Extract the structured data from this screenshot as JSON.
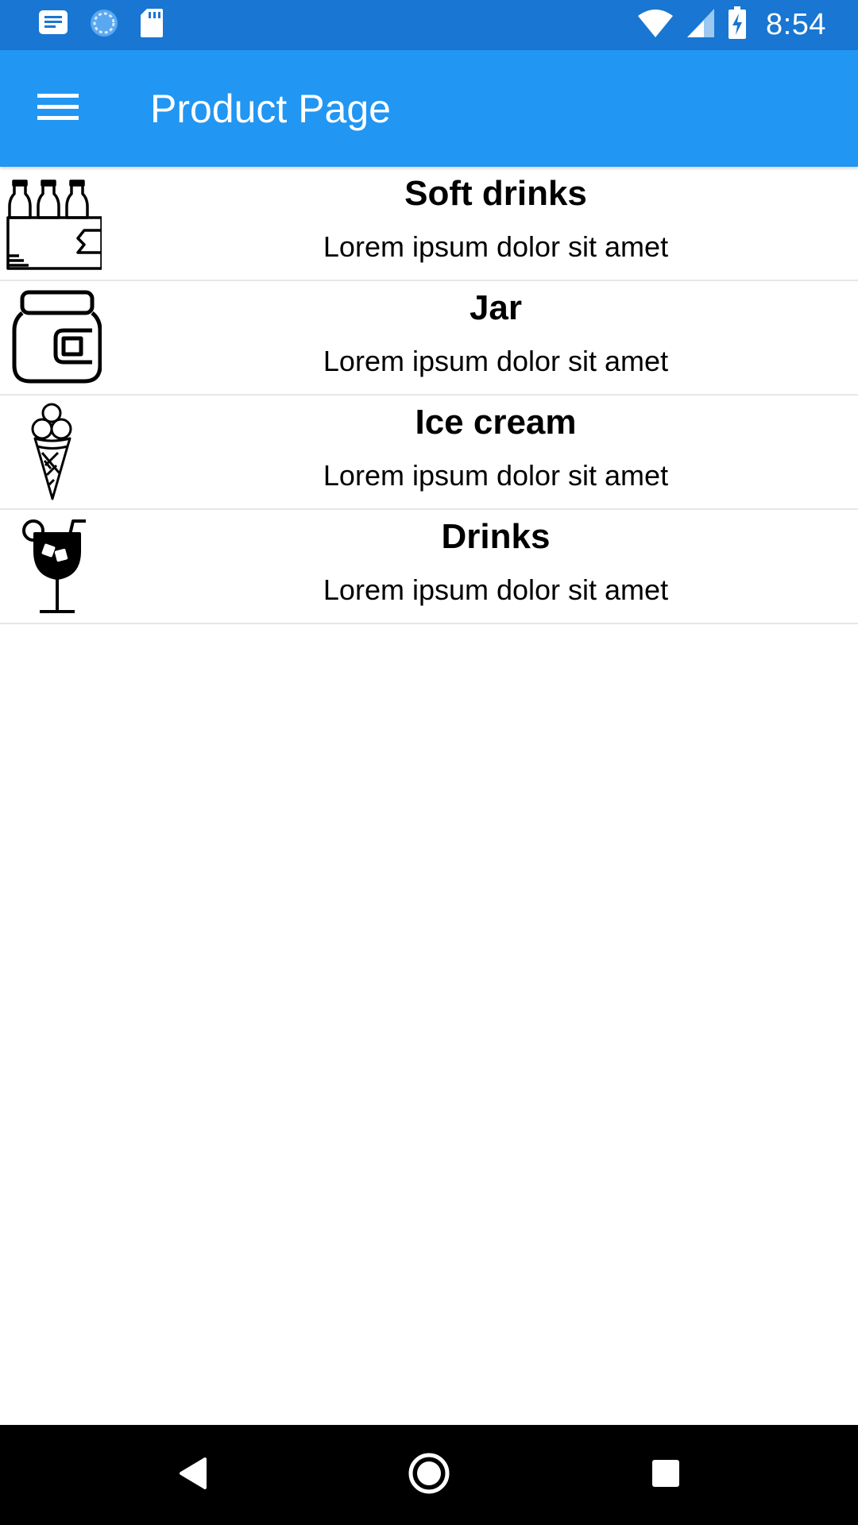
{
  "status_bar": {
    "time": "8:54",
    "left_icons": [
      "message-icon",
      "sync-icon",
      "sd-card-icon"
    ],
    "right_icons": [
      "wifi-icon",
      "signal-icon",
      "battery-charging-icon"
    ]
  },
  "app_bar": {
    "title": "Product Page",
    "menu_icon": "hamburger-menu-icon",
    "background": "#2196f3"
  },
  "products": [
    {
      "icon": "bottles-pack-icon",
      "title": "Soft drinks",
      "description": "Lorem ipsum dolor sit amet"
    },
    {
      "icon": "jar-icon",
      "title": "Jar",
      "description": "Lorem ipsum dolor sit amet"
    },
    {
      "icon": "ice-cream-cone-icon",
      "title": "Ice cream",
      "description": "Lorem ipsum dolor sit amet"
    },
    {
      "icon": "cocktail-glass-icon",
      "title": "Drinks",
      "description": "Lorem ipsum dolor sit amet"
    }
  ],
  "nav_bar": {
    "buttons": [
      "back-icon",
      "home-icon",
      "recents-icon"
    ]
  },
  "colors": {
    "status_bar": "#1976d2",
    "app_bar": "#2196f3",
    "divider": "#e6e6e6",
    "nav_bar": "#000000"
  }
}
